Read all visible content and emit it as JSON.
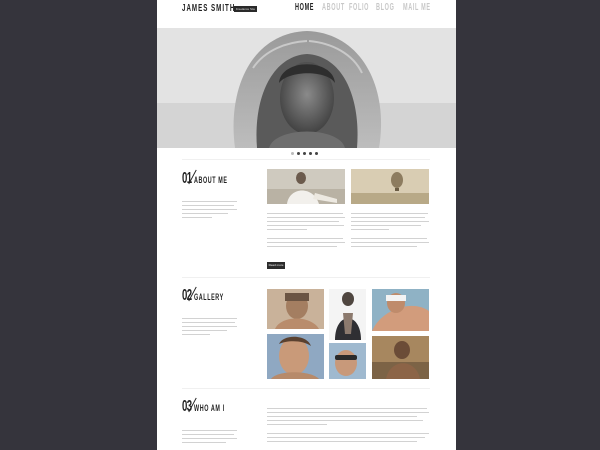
{
  "header": {
    "logo": "JAMES SMITH",
    "tagline": "Freelance Site",
    "nav": [
      "HOME",
      "ABOUT",
      "FOLIO",
      "BLOG",
      "MAIL ME"
    ]
  },
  "slider": {
    "dots": 5,
    "active": 1
  },
  "about": {
    "number": "01",
    "label": "ABOUT ME",
    "more_button": "Read more"
  },
  "gallery": {
    "number": "02",
    "label": "GALLERY",
    "photos": [
      "man-posing-photo",
      "man-portrait-photo",
      "man-in-cap-photo",
      "man-smiling-photo",
      "man-sunglasses-photo",
      "man-on-rocks-photo"
    ]
  },
  "who": {
    "number": "03",
    "label": "WHO AM I"
  },
  "colors": {
    "background": "#35343c",
    "page": "#ffffff",
    "text": "#222222",
    "muted": "#9a9a9a"
  }
}
